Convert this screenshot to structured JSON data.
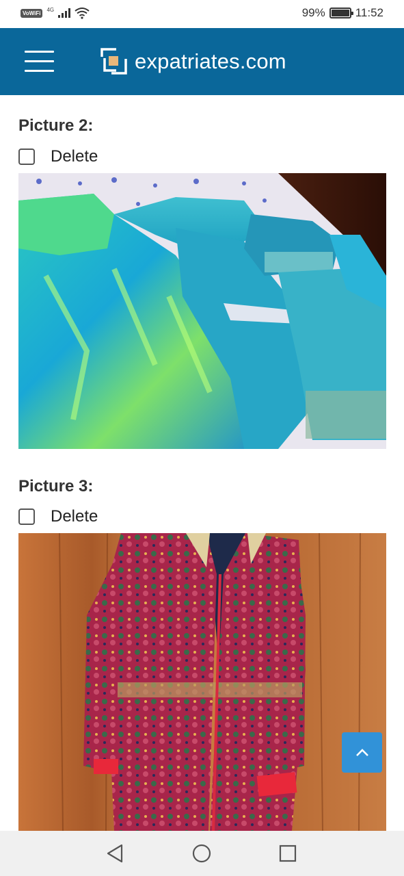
{
  "status_bar": {
    "vowifi": "VoWiFi",
    "network": "4G",
    "battery_percent": "99%",
    "time": "11:52",
    "icons": [
      "signal-icon",
      "wifi-icon",
      "battery-icon"
    ]
  },
  "header": {
    "brand": "expatriates.com",
    "menu_icon": "hamburger-menu-icon",
    "background": "#0a679a"
  },
  "pictures": [
    {
      "title": "Picture 2:",
      "delete_label": "Delete",
      "checked": false
    },
    {
      "title": "Picture 3:",
      "delete_label": "Delete",
      "checked": false
    }
  ],
  "scroll_top": {
    "icon": "chevron-up-icon",
    "color": "#3192d8"
  },
  "nav_bar": {
    "icons": [
      "back-triangle-icon",
      "home-circle-icon",
      "recents-square-icon"
    ]
  }
}
